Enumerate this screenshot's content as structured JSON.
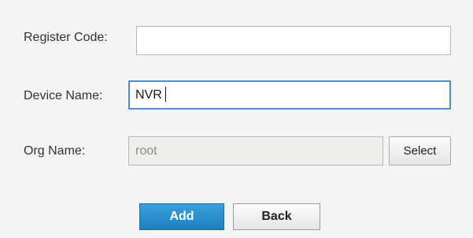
{
  "form": {
    "register_code": {
      "label": "Register Code:",
      "value": ""
    },
    "device_name": {
      "label": "Device Name:",
      "value": "NVR"
    },
    "org_name": {
      "label": "Org Name:",
      "value": "root",
      "select_label": "Select"
    }
  },
  "actions": {
    "add_label": "Add",
    "back_label": "Back"
  },
  "colors": {
    "background": "#f4f4f4",
    "focus_border": "#4a90d9",
    "primary_button": "#2b8fcf"
  }
}
